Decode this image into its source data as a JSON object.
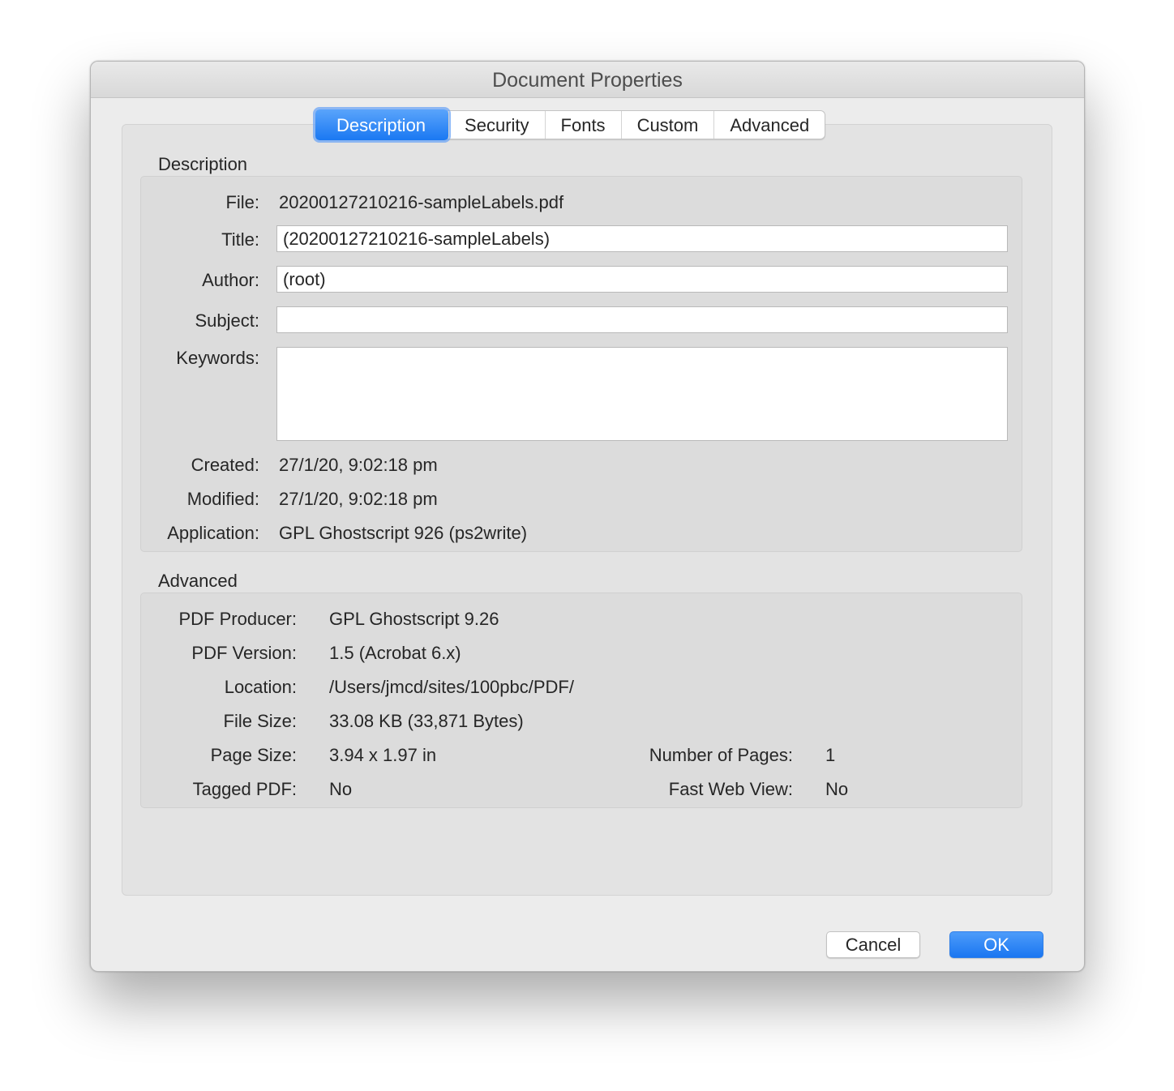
{
  "window": {
    "title": "Document Properties"
  },
  "tabs": [
    {
      "label": "Description",
      "active": true
    },
    {
      "label": "Security",
      "active": false
    },
    {
      "label": "Fonts",
      "active": false
    },
    {
      "label": "Custom",
      "active": false
    },
    {
      "label": "Advanced",
      "active": false
    }
  ],
  "description": {
    "section_title": "Description",
    "file_label": "File:",
    "file_value": "20200127210216-sampleLabels.pdf",
    "title_label": "Title:",
    "title_value": "(20200127210216-sampleLabels)",
    "author_label": "Author:",
    "author_value": "(root)",
    "subject_label": "Subject:",
    "subject_value": "",
    "keywords_label": "Keywords:",
    "keywords_value": "",
    "created_label": "Created:",
    "created_value": "27/1/20, 9:02:18 pm",
    "modified_label": "Modified:",
    "modified_value": "27/1/20, 9:02:18 pm",
    "application_label": "Application:",
    "application_value": "GPL Ghostscript 926 (ps2write)"
  },
  "advanced": {
    "section_title": "Advanced",
    "producer_label": "PDF Producer:",
    "producer_value": "GPL Ghostscript 9.26",
    "version_label": "PDF Version:",
    "version_value": "1.5 (Acrobat 6.x)",
    "location_label": "Location:",
    "location_value": "/Users/jmcd/sites/100pbc/PDF/",
    "filesize_label": "File Size:",
    "filesize_value": "33.08 KB (33,871 Bytes)",
    "pagesize_label": "Page Size:",
    "pagesize_value": "3.94 x 1.97 in",
    "numpages_label": "Number of Pages:",
    "numpages_value": "1",
    "tagged_label": "Tagged PDF:",
    "tagged_value": "No",
    "fastweb_label": "Fast Web View:",
    "fastweb_value": "No"
  },
  "buttons": {
    "cancel": "Cancel",
    "ok": "OK"
  },
  "colors": {
    "accent": "#1a78f2",
    "window_bg": "#ececec",
    "group_bg": "#dcdcdc"
  }
}
